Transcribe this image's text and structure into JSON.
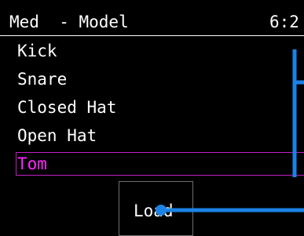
{
  "header": {
    "title": "Med  - Model",
    "time": "6:2"
  },
  "list": {
    "items": [
      {
        "label": "Kick",
        "selected": false
      },
      {
        "label": "Snare",
        "selected": false
      },
      {
        "label": "Closed Hat",
        "selected": false
      },
      {
        "label": "Open Hat",
        "selected": false
      },
      {
        "label": "Tom",
        "selected": true
      }
    ]
  },
  "load_button": {
    "label": "Load"
  },
  "colors": {
    "background": "#000000",
    "text": "#ffffff",
    "selection": "#ff27ff",
    "selection_border": "#c21fc2",
    "connector": "#1b82e6"
  }
}
